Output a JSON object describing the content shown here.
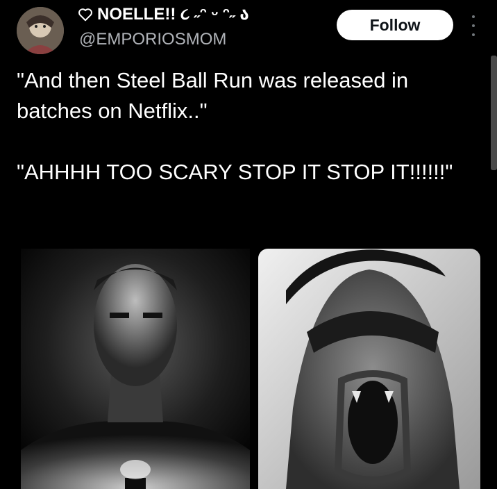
{
  "tweet": {
    "display_name": "NOELLE!! ૮ ˶ᵔ ᵕ ᵔ˶ ა",
    "handle": "@EMPORIOSMOM",
    "follow_label": "Follow",
    "text_lines": [
      "\"And then Steel Ball Run was released in batches on Netflix..\"",
      "\"AHHHH TOO SCARY STOP IT STOP IT!!!!!!\""
    ]
  },
  "icons": {
    "name_prefix": "heart-outline-icon",
    "more": "more-vertical-icon",
    "avatar": "avatar"
  },
  "colors": {
    "background": "#000000",
    "text": "#ffffff",
    "handle": "#b0b3b8",
    "follow_bg": "#ffffff",
    "follow_text": "#0f1419"
  }
}
